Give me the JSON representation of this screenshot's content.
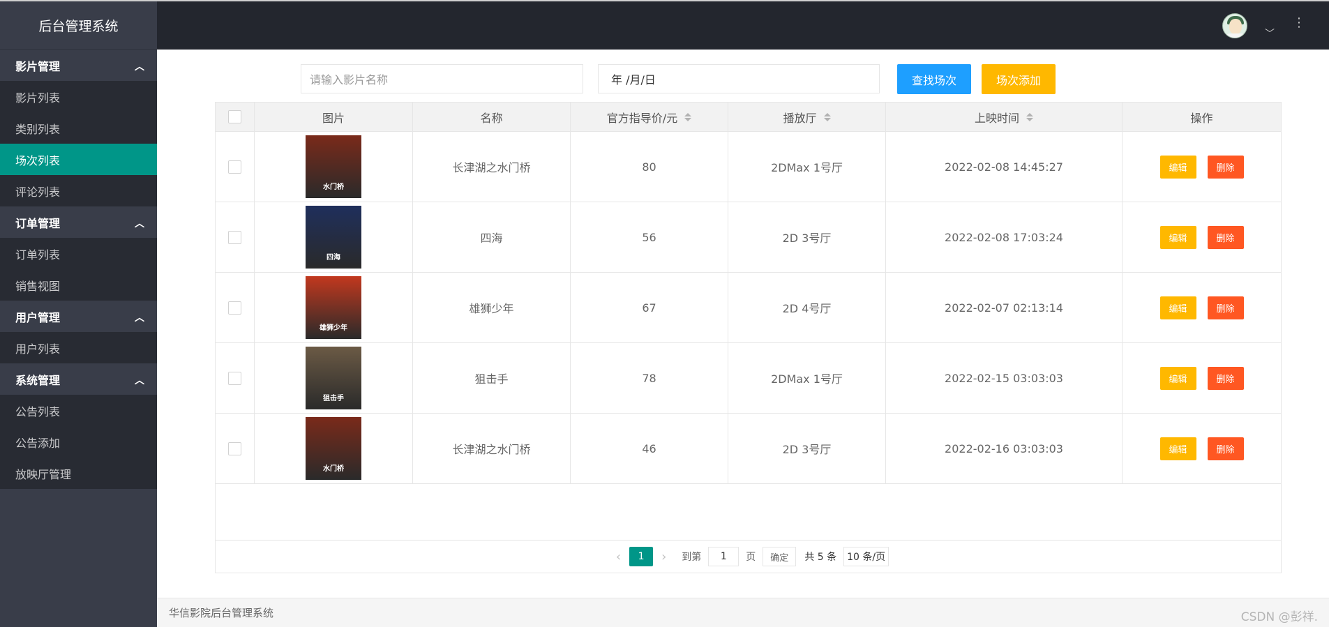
{
  "app": {
    "title": "后台管理系统"
  },
  "sidebar": {
    "groups": [
      {
        "title": "影片管理",
        "items": [
          "影片列表",
          "类别列表",
          "场次列表",
          "评论列表"
        ]
      },
      {
        "title": "订单管理",
        "items": [
          "订单列表",
          "销售视图"
        ]
      },
      {
        "title": "用户管理",
        "items": [
          "用户列表"
        ]
      },
      {
        "title": "系统管理",
        "items": [
          "公告列表",
          "公告添加",
          "放映厅管理"
        ]
      }
    ],
    "active": "场次列表"
  },
  "header": {
    "avatar_icon": "user-avatar",
    "more_icon": "more-vertical-icon"
  },
  "toolbar": {
    "search_placeholder": "请输入影片名称",
    "date_value": "年 /月/日",
    "search_button": "查找场次",
    "add_button": "场次添加"
  },
  "table": {
    "columns": [
      "图片",
      "名称",
      "官方指导价/元",
      "播放厅",
      "上映时间",
      "操作"
    ],
    "rows": [
      {
        "name": "长津湖之水门桥",
        "price": "80",
        "hall": "2DMax 1号厅",
        "time": "2022-02-08 14:45:27",
        "poster_text": "水门桥",
        "poster_color": "#7a2a1a"
      },
      {
        "name": "四海",
        "price": "56",
        "hall": "2D 3号厅",
        "time": "2022-02-08 17:03:24",
        "poster_text": "四海",
        "poster_color": "#1f2f5c"
      },
      {
        "name": "雄狮少年",
        "price": "67",
        "hall": "2D 4号厅",
        "time": "2022-02-07 02:13:14",
        "poster_text": "雄狮少年",
        "poster_color": "#c2381e"
      },
      {
        "name": "狙击手",
        "price": "78",
        "hall": "2DMax 1号厅",
        "time": "2022-02-15 03:03:03",
        "poster_text": "狙击手",
        "poster_color": "#6b5a45"
      },
      {
        "name": "长津湖之水门桥",
        "price": "46",
        "hall": "2D 3号厅",
        "time": "2022-02-16 03:03:03",
        "poster_text": "水门桥",
        "poster_color": "#7a2a1a"
      }
    ],
    "edit_label": "编辑",
    "delete_label": "删除"
  },
  "pagination": {
    "current": "1",
    "goto_label": "到第",
    "page_input": "1",
    "page_unit": "页",
    "confirm_label": "确定",
    "total": "共 5 条",
    "page_size": "10 条/页"
  },
  "footer": {
    "text": "华信影院后台管理系统",
    "watermark": "CSDN @彭祥."
  },
  "colors": {
    "sidebar": "#393d49",
    "active": "#009688",
    "primary": "#1e9fff",
    "warn": "#ffb800",
    "danger": "#ff5722"
  }
}
